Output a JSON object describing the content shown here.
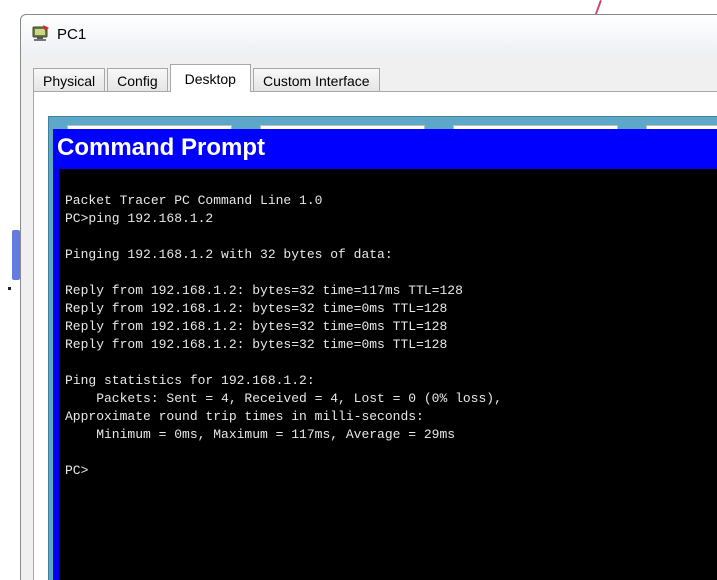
{
  "window": {
    "title": "PC1",
    "icon": "pc-icon"
  },
  "tabs": [
    {
      "label": "Physical",
      "active": false
    },
    {
      "label": "Config",
      "active": false
    },
    {
      "label": "Desktop",
      "active": true
    },
    {
      "label": "Custom Interface",
      "active": false
    }
  ],
  "command_prompt": {
    "title": "Command Prompt",
    "lines": [
      "Packet Tracer PC Command Line 1.0",
      "PC>ping 192.168.1.2",
      "",
      "Pinging 192.168.1.2 with 32 bytes of data:",
      "",
      "Reply from 192.168.1.2: bytes=32 time=117ms TTL=128",
      "Reply from 192.168.1.2: bytes=32 time=0ms TTL=128",
      "Reply from 192.168.1.2: bytes=32 time=0ms TTL=128",
      "Reply from 192.168.1.2: bytes=32 time=0ms TTL=128",
      "",
      "Ping statistics for 192.168.1.2:",
      "    Packets: Sent = 4, Received = 4, Lost = 0 (0% loss),",
      "Approximate round trip times in milli-seconds:",
      "    Minimum = 0ms, Maximum = 117ms, Average = 29ms",
      "",
      "PC>"
    ]
  },
  "colors": {
    "cmd_title_bg": "#0000ff",
    "cmd_body_bg": "#000000",
    "cmd_text": "#e8e8e8",
    "desktop_bg": "#5da8c8"
  }
}
